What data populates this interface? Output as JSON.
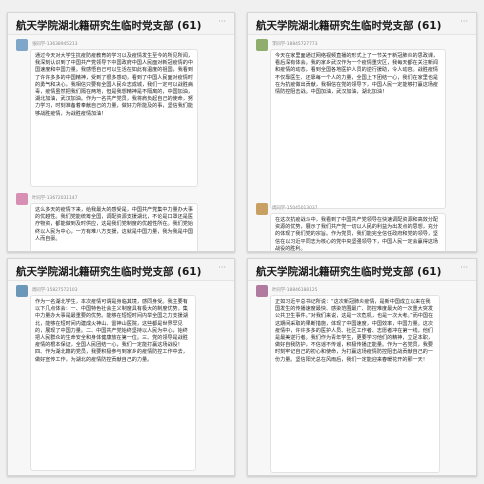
{
  "panels": [
    {
      "title": "航天学院湖北籍研究生临时党支部 (61)",
      "messages": [
        {
          "sender": "张同学-13638945213",
          "avatar_color": "#7fa7c9",
          "text": "通过今天对大学生抗疫防疫教育的学习以及疫情发生至今的所见所闻，我深刻认识到了中国共产党领导下中国政府中国人民面对新冠疫情的中国速度和中国力量。我感悟自己可以生活在如此有温度的祖国，我看到了许许多多的中国精神，受到了很多感动，看到了中国人民面对疫情时的勇气和决心，我相信只要有全国人民众志成城，我们一定可以战胜病毒，疫情虽然把我们隔在两地，但是我想精神是不隔离的，中国加油，湖北加油，武汉加油。作为一名共产党员，我将肩负起自己的使命，努力学习，时刻准备着奉献自己的力量，做好力所能及的事，坚信我们能够战胜疫情，为战胜疫情加油！"
        },
        {
          "sender": "叶同学-13672031147",
          "avatar_color": "#d88fb4",
          "text": "这么多天的疫情下来，给我最大的感受是，中国共产党集中力量办大事的优越性。我们党能统筹全国，调配资源支援湖北，不论是口罩还是医疗物资，都能做到及时供应，这是我们党制度的优越性所在。我们党始终以人民为中心，一方有难八方支援，这就是中国力量，我为我是中国人而自豪。"
        }
      ]
    },
    {
      "title": "航天学院湖北籍研究生临时党支部 (61)",
      "messages": [
        {
          "sender": "李同学-18845727773",
          "avatar_color": "#8fae6e",
          "text": "今天在家里面通过网络视频直播的形式上了一节关于新冠肺炎的思政课，看后深有体会。我的家乡武汉作为一个疫情重灾区，我每天都在关注新闻和疫情的动态，看到全国各地医护人员的逆行援助，令人动容。战胜疫情不仅靠医生、还靠每一个人的力量，全国上下团结一心，我们在家里也是在为抗疫做出贡献，我相信在党的领导下，中国人民一定能够打赢这场疫情防控阻击战。中国加油，武汉加油，湖北加油！"
        },
        {
          "sender": "周同学-15045013037",
          "avatar_color": "#c9a064",
          "text": "在这次抗疫战斗中，我看到了中国共产党领导在快速调配资源和高效分配资源的优势，展示了我们共产党一切以人民的利益为出发点的思想，充分的体现了我们党的宗旨。作为党员，我们能完全信任政府和党的领导，坚信在以习近平同志为核心的党中央坚强领导下，中国人民一定会赢得这场战役的胜利。"
        }
      ]
    },
    {
      "title": "航天学院湖北籍研究生临时党支部 (61)",
      "messages": [
        {
          "sender": "周同学-15827572103",
          "avatar_color": "#6b98b8",
          "text": "作为一名湖北学生，本次疫情可谓是身临其境，感同身受。我主要有以下几点体会：一、中国特色社会主义制度具有极大的制度优势，集中力量办大事是最重要的优势。能够在短短时间内举全国之力支援湖北，能够在短时间内建成火神山、雷神山医院，这些都是世界罕见的，展现了中国力量。二、中国共产党始终坚持以人民为中心，始终把人民群众的生命安全和身体健康放在第一位。三、党的领导是战胜疫情的根本保证，全国人民团结一心，我们一定能打赢这场战役！四、作为湖北籍的党员，我要积极参与到家乡的疫情防控工作中去，做好宣传工作，为湖北的疫情防控贡献自己的力量。"
        }
      ]
    },
    {
      "title": "航天学院湖北籍研究生临时党支部 (61)",
      "messages": [
        {
          "sender": "叶同学-18846188125",
          "avatar_color": "#b07b9e",
          "text": "正如习近平总书记所说：“这次新冠肺炎疫情，是新中国成立以来在我国发生的传播速度最快、感染范围最广、防控难度最大的一次重大突发公共卫生事件。”对我们来说，这是一次危机，也是一次大考。”而中国在这期间采取的果断措施，体现了中国速度，中国效率，中国力量。这次疫情中，许许多多的医护人员、社区工作者、志愿者冲在第一线，他们是最美逆行者。我们作为青年学生，更要学习他们的精神，立足本职，做好自我防护，不信谣不传谣，积极传播正能量。作为一名党员，我要时刻牢记自己的初心和使命，为打赢这场疫情防控阻击战贡献自己的一份力量。坚信阳光总在风雨后，我们一定能迎来春暖花开的那一天！"
        }
      ]
    }
  ]
}
